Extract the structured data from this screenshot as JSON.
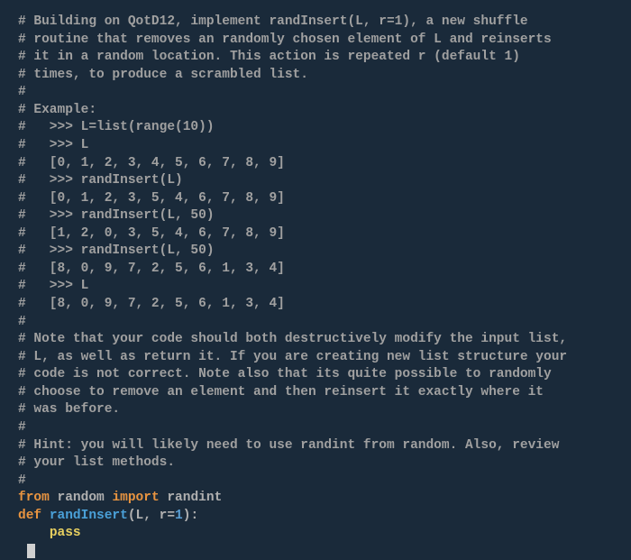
{
  "lines": {
    "l1": "# Building on QotD12, implement randInsert(L, r=1), a new shuffle",
    "l2": "# routine that removes an randomly chosen element of L and reinserts",
    "l3": "# it in a random location. This action is repeated r (default 1)",
    "l4": "# times, to produce a scrambled list.",
    "l5": "#",
    "l6": "# Example:",
    "l7": "#   >>> L=list(range(10))",
    "l8": "#   >>> L",
    "l9": "#   [0, 1, 2, 3, 4, 5, 6, 7, 8, 9]",
    "l10": "#   >>> randInsert(L)",
    "l11": "#   [0, 1, 2, 3, 5, 4, 6, 7, 8, 9]",
    "l12": "#   >>> randInsert(L, 50)",
    "l13": "#   [1, 2, 0, 3, 5, 4, 6, 7, 8, 9]",
    "l14": "#   >>> randInsert(L, 50)",
    "l15": "#   [8, 0, 9, 7, 2, 5, 6, 1, 3, 4]",
    "l16": "#   >>> L",
    "l17": "#   [8, 0, 9, 7, 2, 5, 6, 1, 3, 4]",
    "l18": "#",
    "l19": "# Note that your code should both destructively modify the input list,",
    "l20": "# L, as well as return it. If you are creating new list structure your",
    "l21": "# code is not correct. Note also that its quite possible to randomly",
    "l22": "# choose to remove an element and then reinsert it exactly where it",
    "l23": "# was before.",
    "l24": "#",
    "l25": "# Hint: you will likely need to use randint from random. Also, review",
    "l26": "# your list methods.",
    "l27": "#"
  },
  "code": {
    "kw_from": "from",
    "mod_random": " random ",
    "kw_import": "import",
    "mod_randint": " randint",
    "kw_def": "def ",
    "fn_name": "randInsert",
    "fn_sig_open": "(L, r=",
    "fn_sig_num": "1",
    "fn_sig_close": "):",
    "indent": "    ",
    "kw_pass": "pass"
  }
}
